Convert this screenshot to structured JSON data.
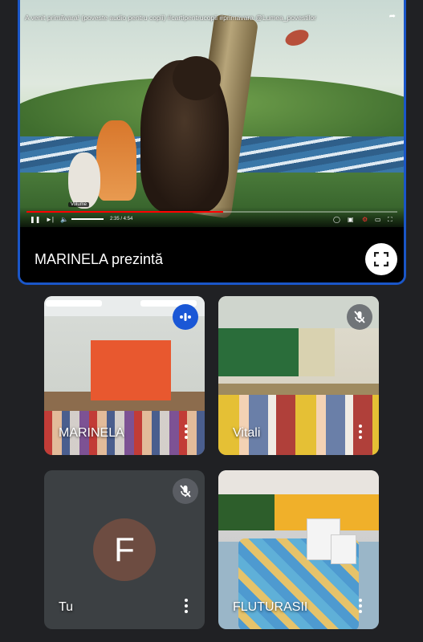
{
  "presentation": {
    "video_title": "A venit primăvara! (poveste audio pentru copii) #cartipentrucopii #primavara @Lumea_povestilor",
    "volume_tooltip": "Volume",
    "time": "2:35 / 4:54",
    "progress": 0.53,
    "presenter_label": "MARINELA prezintă"
  },
  "participants": [
    {
      "name": "MARINELA",
      "status": "speaking"
    },
    {
      "name": "Vitali",
      "status": "muted"
    },
    {
      "name": "Tu",
      "avatar_letter": "F",
      "avatar_color": "#6d4c41",
      "status": "muted"
    },
    {
      "name": "FLUTURASII",
      "status": "unmuted"
    }
  ],
  "colors": {
    "background": "#202124",
    "presenting_border": "#1a56c8",
    "speaking_badge": "#1a57d6",
    "muted_badge": "#5f6368"
  },
  "icons": {
    "fullscreen": "fullscreen-icon",
    "mic_off": "mic-off-icon",
    "speaking": "audio-level-icon",
    "more": "more-vert-icon"
  }
}
